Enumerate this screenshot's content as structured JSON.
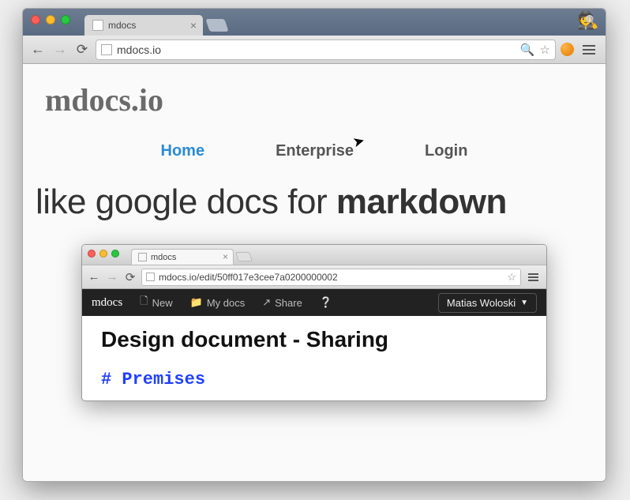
{
  "outer_browser": {
    "tab_title": "mdocs",
    "url": "mdocs.io"
  },
  "page": {
    "brand": "mdocs.io",
    "nav": [
      "Home",
      "Enterprise",
      "Login"
    ],
    "nav_active_index": 0,
    "tagline_light": "like google docs for ",
    "tagline_bold": "markdown"
  },
  "inner_browser": {
    "tab_title": "mdocs",
    "url": "mdocs.io/edit/50ff017e3cee7a0200000002"
  },
  "app": {
    "logo": "mdocs",
    "menu": {
      "new": "New",
      "mydocs": "My docs",
      "share": "Share"
    },
    "user": "Matias Woloski"
  },
  "doc": {
    "title": "Design document - Sharing",
    "heading_md": "# Premises"
  }
}
